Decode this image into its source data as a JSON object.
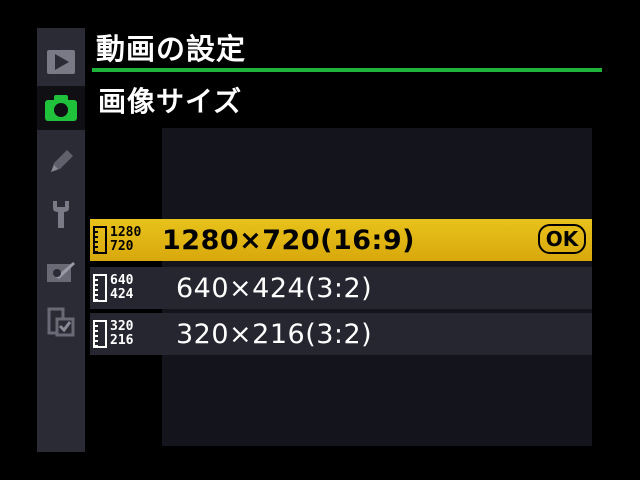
{
  "header": {
    "title": "動画の設定",
    "subtitle": "画像サイズ"
  },
  "tabs": [
    {
      "icon": "playback-icon",
      "active": false
    },
    {
      "icon": "camera-icon",
      "active": true
    },
    {
      "icon": "pencil-icon",
      "active": false
    },
    {
      "icon": "wrench-icon",
      "active": false
    },
    {
      "icon": "retouch-icon",
      "active": false
    },
    {
      "icon": "recent-settings-icon",
      "active": false
    }
  ],
  "options": [
    {
      "icon_top": "1280",
      "icon_bottom": "720",
      "label": "1280×720(16:9)",
      "selected": true,
      "ok": "OK"
    },
    {
      "icon_top": "640",
      "icon_bottom": "424",
      "label": "640×424(3:2)",
      "selected": false
    },
    {
      "icon_top": "320",
      "icon_bottom": "216",
      "label": "320×216(3:2)",
      "selected": false
    }
  ],
  "colors": {
    "accent_rule": "#1fb33a",
    "active_tab_icon": "#21c23b",
    "selection": "#e3b816"
  }
}
